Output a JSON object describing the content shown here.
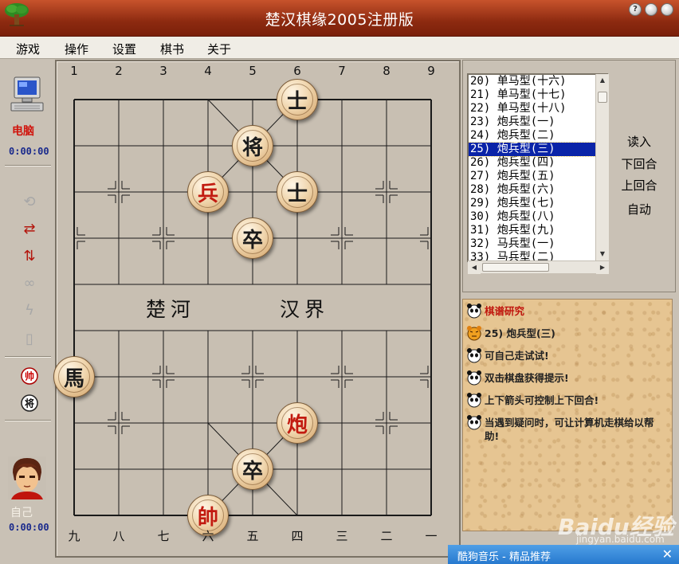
{
  "window": {
    "title": "楚汉棋缘2005注册版",
    "help_btn": "?",
    "minimize_btn": "",
    "close_btn": ""
  },
  "menu": [
    "游戏",
    "操作",
    "设置",
    "棋书",
    "关于"
  ],
  "left": {
    "computer_label": "电脑",
    "computer_time": "0:00:00",
    "self_label": "自己",
    "self_time": "0:00:00"
  },
  "board": {
    "top_coords": [
      "1",
      "2",
      "3",
      "4",
      "5",
      "6",
      "7",
      "8",
      "9"
    ],
    "bottom_coords": [
      "九",
      "八",
      "七",
      "六",
      "五",
      "四",
      "三",
      "二",
      "一"
    ],
    "river_left": "楚河",
    "river_right": "汉界",
    "pieces": [
      {
        "char": "士",
        "color": "black",
        "file": 5,
        "rank": 0
      },
      {
        "char": "将",
        "color": "black",
        "file": 4,
        "rank": 1
      },
      {
        "char": "兵",
        "color": "red",
        "file": 3,
        "rank": 2
      },
      {
        "char": "士",
        "color": "black",
        "file": 5,
        "rank": 2
      },
      {
        "char": "卒",
        "color": "black",
        "file": 4,
        "rank": 3
      },
      {
        "char": "馬",
        "color": "black",
        "file": 0,
        "rank": 6
      },
      {
        "char": "炮",
        "color": "red",
        "file": 5,
        "rank": 7
      },
      {
        "char": "卒",
        "color": "black",
        "file": 4,
        "rank": 8
      },
      {
        "char": "帥",
        "color": "red",
        "file": 3,
        "rank": 9
      }
    ]
  },
  "records": {
    "items": [
      "20) 单马型(十六)",
      "21) 单马型(十七)",
      "22) 单马型(十八)",
      "23) 炮兵型(一)",
      "24) 炮兵型(二)",
      "25) 炮兵型(三)",
      "26) 炮兵型(四)",
      "27) 炮兵型(五)",
      "28) 炮兵型(六)",
      "29) 炮兵型(七)",
      "30) 炮兵型(八)",
      "31) 炮兵型(九)",
      "32) 马兵型(一)",
      "33) 马兵型(二)"
    ],
    "selected_index": 5,
    "buttons": [
      "读入",
      "下回合",
      "上回合",
      "自动"
    ]
  },
  "chat": {
    "heading": "棋谱研究",
    "lines": [
      "25) 炮兵型(三)",
      "可自己走试试!",
      "双击棋盘获得提示!",
      "上下箭头可控制上下回合!",
      "当遇到疑问时，可让计算机走棋给以帮助!"
    ]
  },
  "notification": {
    "text": "酷狗音乐 - 精品推荐",
    "close": "✕"
  },
  "watermark": {
    "logo": "Baidu经验",
    "url": "jingyan.baidu.com"
  }
}
